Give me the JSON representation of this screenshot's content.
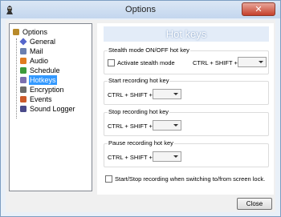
{
  "window": {
    "title": "Options",
    "close_glyph": "✕"
  },
  "tree": {
    "items": [
      {
        "label": "Options",
        "icon": "folder-icon",
        "color": "#b88a2a"
      },
      {
        "label": "General",
        "icon": "diamond-icon",
        "color": "#5566cc"
      },
      {
        "label": "Mail",
        "icon": "mail-icon",
        "color": "#6a7fb0"
      },
      {
        "label": "Audio",
        "icon": "audio-icon",
        "color": "#e07b20"
      },
      {
        "label": "Schedule",
        "icon": "clock-icon",
        "color": "#3c9a3c"
      },
      {
        "label": "Hotkeys",
        "icon": "hotkeys-icon",
        "color": "#7a6fb0",
        "selected": true
      },
      {
        "label": "Encryption",
        "icon": "lock-icon",
        "color": "#6c6c6c"
      },
      {
        "label": "Events",
        "icon": "events-icon",
        "color": "#cc5a2a"
      },
      {
        "label": "Sound Logger",
        "icon": "sound-logger-icon",
        "color": "#4a4a8a"
      }
    ]
  },
  "pane": {
    "header": "Hot keys",
    "stealth": {
      "legend": "Stealth mode ON/OFF hot key",
      "checkbox_label": "Activate stealth mode",
      "checked": false,
      "modifier": "CTRL + SHIFT +",
      "key": ""
    },
    "start": {
      "legend": "Start recording hot key",
      "modifier": "CTRL + SHIFT +",
      "key": ""
    },
    "stop": {
      "legend": "Stop recording hot key",
      "modifier": "CTRL + SHIFT +",
      "key": ""
    },
    "pause": {
      "legend": "Pause recording hot key",
      "modifier": "CTRL + SHIFT +",
      "key": ""
    },
    "screen_lock": {
      "label": "Start/Stop recording when switching to/from screen lock.",
      "checked": false
    }
  },
  "footer": {
    "close_label": "Close"
  }
}
